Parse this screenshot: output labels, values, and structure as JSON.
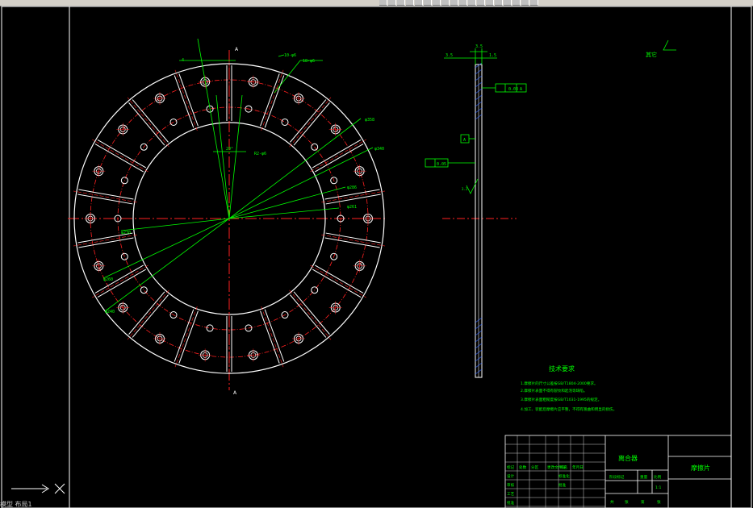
{
  "app": {
    "toolbar_buttons": 18,
    "status_text": "模型  布局1"
  },
  "drawing": {
    "colors": {
      "background": "#000000",
      "outline": "#ffffff",
      "center": "#ff2020",
      "dimension": "#00ff00",
      "hatch": "#3366ff",
      "frame": "#ffffff"
    },
    "front_view": {
      "pad_count": 18,
      "section_marks": [
        "A",
        "A"
      ],
      "dims": [
        "4",
        "10-φ6",
        "18-φ6",
        "φ358",
        "φ340",
        "φ286",
        "φ261",
        "φ240",
        "φ260",
        "φ230",
        "20°",
        "R2-φ6"
      ]
    },
    "side_view": {
      "dims": [
        "3.5",
        "3.5",
        "1.5"
      ],
      "tolerances": [
        "0.03",
        "A",
        "0.05",
        "A"
      ],
      "roughness": "3.2"
    },
    "roughness_note": "其它",
    "tech_requirements": {
      "title": "技术要求",
      "items": [
        "1.摩擦片的尺寸公差按GB/T1804-2000要求。",
        "2.摩擦片表面不得有裂纹和起泡等缺陷。",
        "3.摩擦片表面粗糙度按GB/T1031-1995的规定。",
        "4.加工、装配后摩擦片应平整，不得有翘曲和明显的损伤。"
      ]
    },
    "title_block": {
      "assembly": "离合器",
      "part": "摩擦片",
      "material_label": "阶段标记",
      "weight_label": "重量",
      "scale_label": "比例",
      "scale_value": "1:1",
      "sheet_row": [
        "共",
        "张",
        "第",
        "张"
      ],
      "rev_header": [
        "标记",
        "处数",
        "分区",
        "更改文件号",
        "签名",
        "年月日"
      ],
      "roles": [
        "设计",
        "审核",
        "工艺",
        "批准"
      ],
      "std_labels": [
        "标准化",
        "批准"
      ]
    }
  }
}
